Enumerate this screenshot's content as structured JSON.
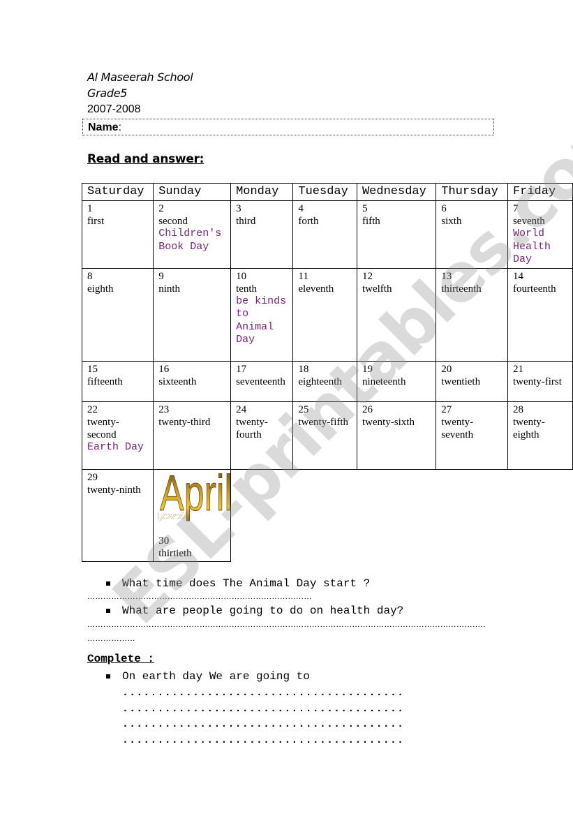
{
  "header": {
    "school": "Al Maseerah School",
    "grade": "Grade5",
    "year": "2007-2008",
    "name_label": "Name",
    "name_colon": ":"
  },
  "sections": {
    "read_title": "Read and answer:",
    "complete_title": "Complete :"
  },
  "calendar": {
    "month_art_label": "April",
    "event_color": "#7a1f7a",
    "days_of_week": [
      "Saturday",
      "Sunday",
      "Monday",
      "Tuesday",
      "Wednesday",
      "Thursday",
      "Friday"
    ],
    "weeks": [
      [
        {
          "num": "1",
          "ord": "first"
        },
        {
          "num": "2",
          "ord": "second",
          "event": "Children's Book Day"
        },
        {
          "num": "3",
          "ord": "third"
        },
        {
          "num": "4",
          "ord": "forth"
        },
        {
          "num": "5",
          "ord": "fifth"
        },
        {
          "num": "6",
          "ord": "sixth"
        },
        {
          "num": "7",
          "ord": "seventh",
          "event": "World Health Day"
        }
      ],
      [
        {
          "num": "8",
          "ord": "eighth"
        },
        {
          "num": "9",
          "ord": "ninth"
        },
        {
          "num": "10",
          "ord": "tenth",
          "event": "be kinds to Animal Day"
        },
        {
          "num": "11",
          "ord": "eleventh"
        },
        {
          "num": "12",
          "ord": "twelfth"
        },
        {
          "num": "13",
          "ord": "thirteenth"
        },
        {
          "num": "14",
          "ord": "fourteenth"
        }
      ],
      [
        {
          "num": "15",
          "ord": "fifteenth"
        },
        {
          "num": "16",
          "ord": "sixteenth"
        },
        {
          "num": "17",
          "ord": "seventeenth"
        },
        {
          "num": "18",
          "ord": "eighteenth"
        },
        {
          "num": "19",
          "ord": "nineteenth"
        },
        {
          "num": "20",
          "ord": "twentieth"
        },
        {
          "num": "21",
          "ord": "twenty-first"
        }
      ],
      [
        {
          "num": "22",
          "ord": "twenty-second",
          "event": "Earth Day"
        },
        {
          "num": "23",
          "ord": "twenty-third"
        },
        {
          "num": "24",
          "ord": "twenty-fourth"
        },
        {
          "num": "25",
          "ord": "twenty-fifth"
        },
        {
          "num": "26",
          "ord": "twenty-sixth"
        },
        {
          "num": "27",
          "ord": "twenty-seventh"
        },
        {
          "num": "28",
          "ord": "twenty-eighth"
        }
      ],
      [
        {
          "num": "29",
          "ord": "twenty-ninth"
        },
        {
          "num": "30",
          "ord": "thirtieth"
        }
      ]
    ]
  },
  "questions": [
    {
      "text": "What time does The Animal Day start ?"
    },
    {
      "text": "What are people going to do on health day?"
    }
  ],
  "answer_lines": {
    "short": "…………………………………………………………………………",
    "long": "……………………………………………………………………………………………………………………………………",
    "tail": "………………"
  },
  "complete": {
    "prompt": "On earth day We are going to",
    "blank_line": "........................................"
  },
  "watermark": "ESL-printables.com"
}
